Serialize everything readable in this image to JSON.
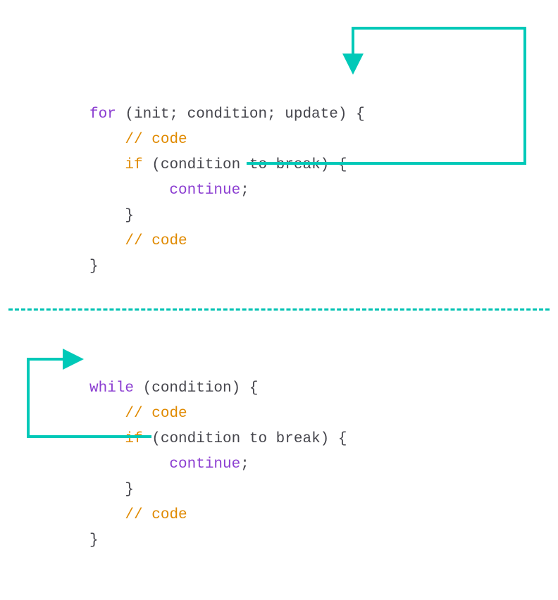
{
  "colors": {
    "keyword_purple": "#8b3dd1",
    "keyword_orange": "#e08a00",
    "text": "#45454c",
    "arrow": "#00c9b8",
    "divider": "#00c2b2"
  },
  "for_block": {
    "l1_for": "for",
    "l1_rest": " (init; condition; update) {",
    "l2_slash": "//",
    "l2_rest": " code",
    "l3_if": "if",
    "l3_rest": " (condition to break) {",
    "l4_cont": "continue",
    "l4_semi": ";",
    "l5": "}",
    "l6_slash": "//",
    "l6_rest": " code",
    "l7": "}"
  },
  "while_block": {
    "l1_while": "while",
    "l1_rest": " (condition) {",
    "l2_slash": "//",
    "l2_rest": " code",
    "l3_if": "if",
    "l3_rest": " (condition to break) {",
    "l4_cont": "continue",
    "l4_semi": ";",
    "l5": "}",
    "l6_slash": "//",
    "l6_rest": " code",
    "l7": "}"
  }
}
